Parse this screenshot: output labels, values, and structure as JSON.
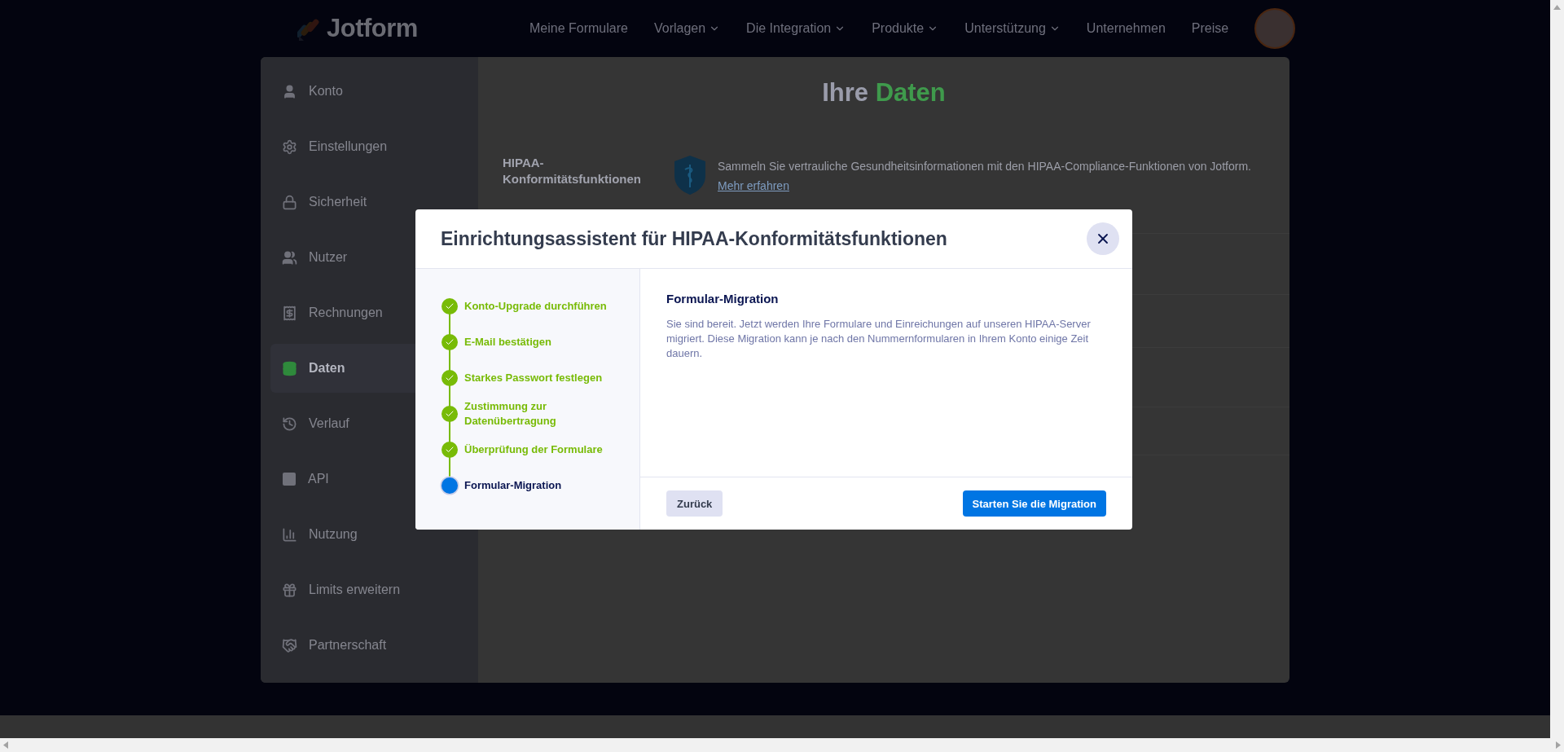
{
  "header": {
    "logo_text": "Jotform",
    "nav": [
      {
        "label": "Meine Formulare",
        "dropdown": false
      },
      {
        "label": "Vorlagen",
        "dropdown": true
      },
      {
        "label": "Die Integration",
        "dropdown": true
      },
      {
        "label": "Produkte",
        "dropdown": true
      },
      {
        "label": "Unterstützung",
        "dropdown": true
      },
      {
        "label": "Unternehmen",
        "dropdown": false
      },
      {
        "label": "Preise",
        "dropdown": false
      }
    ]
  },
  "sidebar": {
    "items": [
      {
        "label": "Konto",
        "selected": false
      },
      {
        "label": "Einstellungen",
        "selected": false
      },
      {
        "label": "Sicherheit",
        "selected": false
      },
      {
        "label": "Nutzer",
        "selected": false
      },
      {
        "label": "Rechnungen",
        "selected": false
      },
      {
        "label": "Daten",
        "selected": true
      },
      {
        "label": "Verlauf",
        "selected": false
      },
      {
        "label": "API",
        "selected": false
      },
      {
        "label": "Nutzung",
        "selected": false
      },
      {
        "label": "Limits erweitern",
        "selected": false
      },
      {
        "label": "Partnerschaft",
        "selected": false
      }
    ]
  },
  "content": {
    "title_lead": "Ihre",
    "title_highlight": "Daten",
    "hipaa": {
      "label": "HIPAA-Konformitätsfunktionen",
      "description": "Sammeln Sie vertrauliche Gesundheitsinformationen mit den HIPAA-Compliance-Funktionen von Jotform.",
      "link": "Mehr erfahren"
    }
  },
  "modal": {
    "title": "Einrichtungsassistent für HIPAA-Konformitätsfunktionen",
    "steps": [
      {
        "label": "Konto-Upgrade durchführen",
        "done": true
      },
      {
        "label": "E-Mail bestätigen",
        "done": true
      },
      {
        "label": "Starkes Passwort festlegen",
        "done": true
      },
      {
        "label": "Zustimmung zur Datenübertragung",
        "done": true
      },
      {
        "label": "Überprüfung der Formulare",
        "done": true
      },
      {
        "label": "Formular-Migration",
        "done": false
      }
    ],
    "step_title": "Formular-Migration",
    "step_text": "Sie sind bereit. Jetzt werden Ihre Formulare und Einreichungen auf unseren HIPAA-Server migriert. Diese Migration kann je nach den Nummernformularen in Ihrem Konto einige Zeit dauern.",
    "back_button": "Zurück",
    "primary_button": "Starten Sie die Migration"
  }
}
